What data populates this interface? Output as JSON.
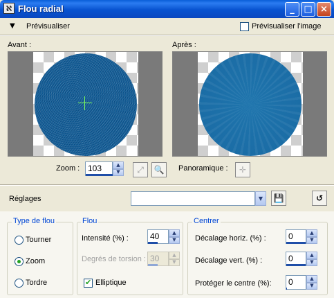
{
  "window": {
    "title": "Flou radial",
    "icon": "ps-icon",
    "controls": [
      "_",
      "□",
      "×"
    ]
  },
  "preview_bar": {
    "toggle_label": "Prévisualiser",
    "preview_image_label": "Prévisualiser l'image",
    "preview_image_checked": false
  },
  "before": {
    "label": "Avant :"
  },
  "after": {
    "label": "Après :"
  },
  "zoom": {
    "label": "Zoom :",
    "value": "103"
  },
  "pan": {
    "label": "Panoramique :"
  },
  "presets": {
    "label": "Réglages",
    "value": ""
  },
  "blur_type": {
    "title": "Type de flou",
    "options": [
      "Tourner",
      "Zoom",
      "Tordre"
    ],
    "selected": "Zoom"
  },
  "blur": {
    "title": "Flou",
    "intensity_label": "Intensité (%) :",
    "intensity_value": "40",
    "twist_label": "Degrés de torsion :",
    "twist_value": "30",
    "elliptic_label": "Elliptique",
    "elliptic_checked": true
  },
  "center": {
    "title": "Centrer",
    "h_offset_label": "Décalage horiz. (%) :",
    "h_offset_value": "0",
    "v_offset_label": "Décalage vert. (%) :",
    "v_offset_value": "0",
    "protect_label": "Protéger le centre (%):",
    "protect_value": "0"
  },
  "colors": {
    "titlebar": "#0a5fd8",
    "accent_text": "#0046d5",
    "disc": "#12609a"
  }
}
